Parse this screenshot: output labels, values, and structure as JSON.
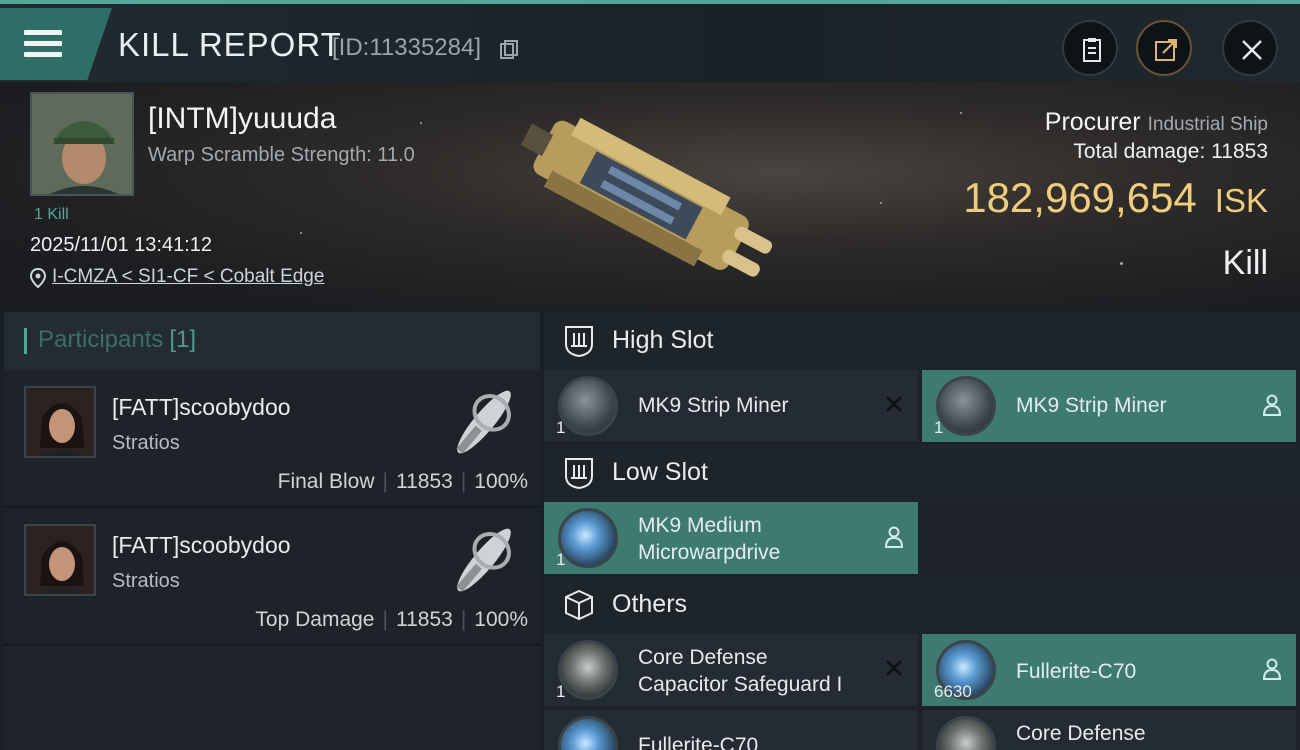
{
  "header": {
    "title": "KILL REPORT",
    "report_id": "[ID:11335284]"
  },
  "victim": {
    "name": "[INTM]yuuuda",
    "warp_scramble": "Warp Scramble Strength: 11.0",
    "kill_count": "1 Kill",
    "datetime": "2025/11/01 13:41:12",
    "location": "I-CMZA < SI1-CF < Cobalt Edge"
  },
  "ship": {
    "name": "Procurer",
    "class": "Industrial Ship",
    "total_damage_label": "Total damage:",
    "total_damage": "11853",
    "isk_value": "182,969,654",
    "isk_unit": "ISK",
    "result": "Kill"
  },
  "participants": {
    "title": "Participants",
    "count": "[1]",
    "rows": [
      {
        "name": "[FATT]scoobydoo",
        "ship": "Stratios",
        "role": "Final Blow",
        "damage": "11853",
        "percent": "100%"
      },
      {
        "name": "[FATT]scoobydoo",
        "ship": "Stratios",
        "role": "Top Damage",
        "damage": "11853",
        "percent": "100%"
      }
    ]
  },
  "slots": {
    "high": {
      "label": "High Slot",
      "items": [
        {
          "name": "MK9 Strip Miner",
          "qty": "1",
          "state": "destroyed"
        },
        {
          "name": "MK9 Strip Miner",
          "qty": "1",
          "state": "dropped"
        }
      ]
    },
    "low": {
      "label": "Low Slot",
      "items": [
        {
          "name_line1": "MK9 Medium",
          "name_line2": "Microwarpdrive",
          "qty": "1",
          "state": "dropped"
        }
      ]
    },
    "others": {
      "label": "Others",
      "items": [
        {
          "name_line1": "Core Defense",
          "name_line2": "Capacitor Safeguard I",
          "qty": "1",
          "state": "destroyed"
        },
        {
          "name": "Fullerite-C70",
          "qty": "6630",
          "state": "dropped"
        },
        {
          "name": "Fullerite-C70",
          "state": "destroyed"
        },
        {
          "name": "Core Defense",
          "state": "destroyed"
        }
      ]
    }
  },
  "colors": {
    "accent": "#4fa89a",
    "isk": "#f0cd7e",
    "dropped_bg": "#3d7b72"
  }
}
